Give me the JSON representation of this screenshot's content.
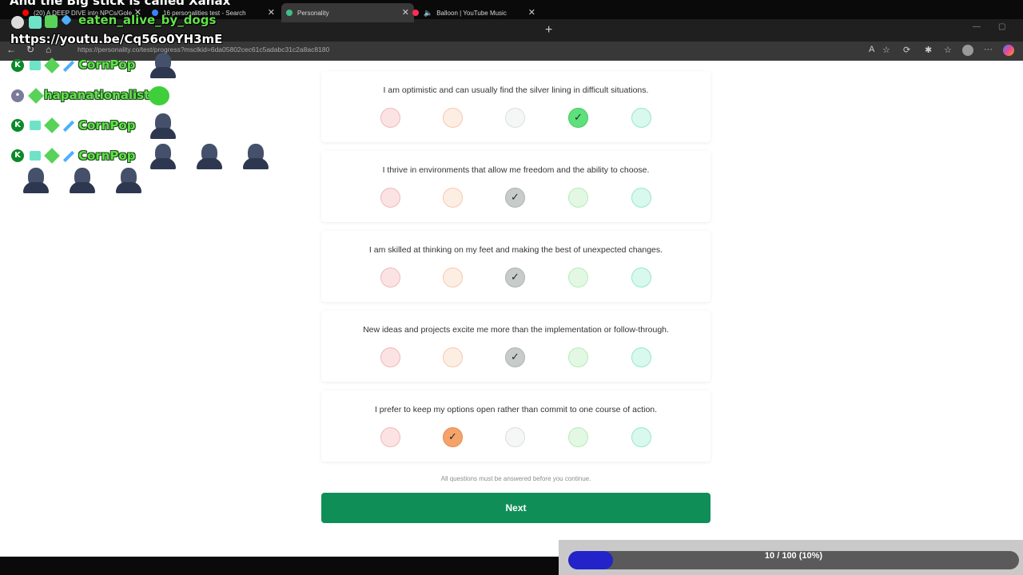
{
  "overlay": {
    "title": "And the Big stick is called Xanax",
    "username": "eaten_alive_by_dogs",
    "link": "https://youtu.be/Cq56o0YH3mE"
  },
  "browser": {
    "tabs": [
      {
        "label": "(20) A DEEP DIVE into NPCs/Gole",
        "favicon_color": "#ff0000"
      },
      {
        "label": "16 personalities test - Search",
        "favicon_color": "#3b82f6"
      },
      {
        "label": "Personality",
        "favicon_color": "#3fbf8a"
      },
      {
        "label": "Balloon | YouTube Music",
        "favicon_color": "#ff2d55"
      }
    ],
    "url": "https://personality.co/test/progress?msclkid=6da05802cec61c5adabc31c2a8ac8180"
  },
  "chat": [
    {
      "name": "CornPop"
    },
    {
      "name": "hapanationalist"
    },
    {
      "name": "CornPop"
    },
    {
      "name": "CornPop"
    }
  ],
  "questions": [
    {
      "text": "I am optimistic and can usually find the silver lining in difficult situations.",
      "selected": 4
    },
    {
      "text": "I thrive in environments that allow me freedom and the ability to choose.",
      "selected": 3
    },
    {
      "text": "I am skilled at thinking on my feet and making the best of unexpected changes.",
      "selected": 3
    },
    {
      "text": "New ideas and projects excite me more than the implementation or follow-through.",
      "selected": 3
    },
    {
      "text": "I prefer to keep my options open rather than commit to one course of action.",
      "selected": 2
    }
  ],
  "note": "All questions must be answered before you continue.",
  "next_label": "Next",
  "progress": {
    "label": "10 / 100 (10%)",
    "fraction": 0.1
  },
  "colors": {
    "accent": "#0f8f57",
    "progress_fill": "#2323c9",
    "chat_name": "#62e24b"
  }
}
